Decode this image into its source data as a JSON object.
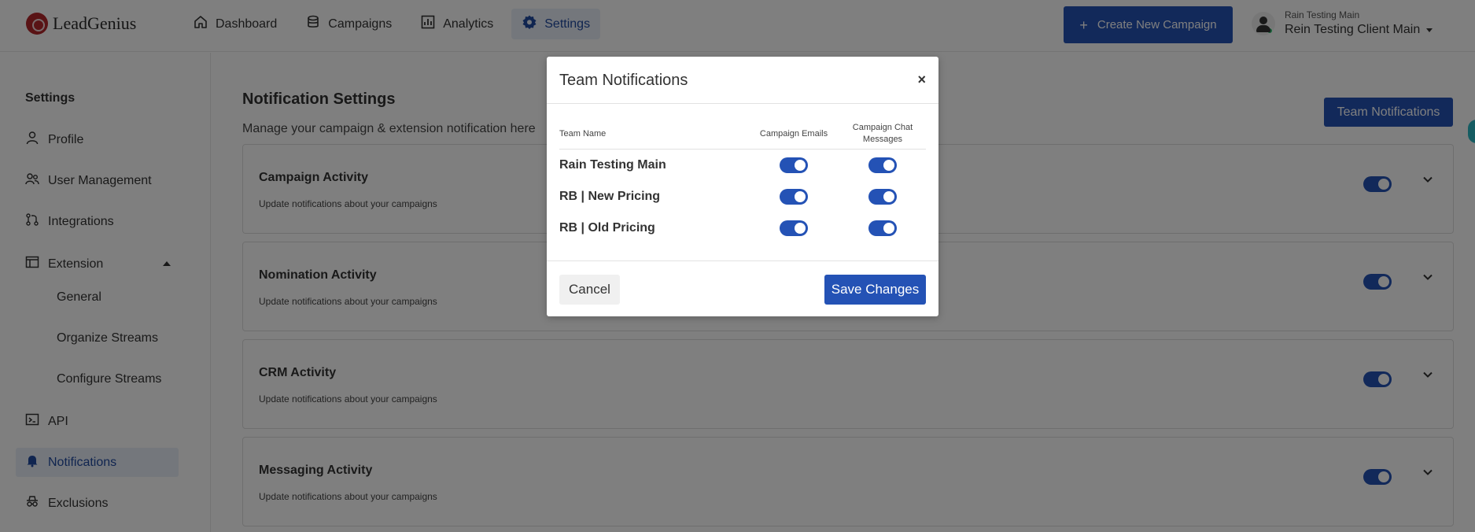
{
  "app": {
    "logo_text": "LeadGenius",
    "nav": [
      {
        "label": "Dashboard",
        "icon": "home-icon"
      },
      {
        "label": "Campaigns",
        "icon": "database-icon"
      },
      {
        "label": "Analytics",
        "icon": "chart-icon"
      },
      {
        "label": "Settings",
        "icon": "gear-icon"
      }
    ],
    "active_nav": "Settings",
    "create_button_label": "Create New Campaign",
    "account_small": "Rain Testing Main",
    "account_main": "Rein Testing Client Main"
  },
  "sidebar": {
    "title": "Settings",
    "items": [
      {
        "label": "Profile",
        "icon": "user-icon"
      },
      {
        "label": "User Management",
        "icon": "users-icon"
      },
      {
        "label": "Integrations",
        "icon": "integration-icon"
      },
      {
        "label": "Extension",
        "icon": "window-icon"
      },
      {
        "label": "API",
        "icon": "terminal-icon"
      },
      {
        "label": "Notifications",
        "icon": "bell-icon"
      },
      {
        "label": "Exclusions",
        "icon": "incognito-icon"
      }
    ],
    "extension_subitems": [
      "General",
      "Organize Streams",
      "Configure Streams"
    ],
    "active_item": "Notifications"
  },
  "main": {
    "title": "Notification Settings",
    "subtitle": "Manage your campaign & extension notification here",
    "team_notifications_button": "Team Notifications",
    "cards": [
      {
        "title": "Campaign Activity",
        "description": "Update notifications about your campaigns",
        "enabled": true
      },
      {
        "title": "Nomination Activity",
        "description": "Update notifications about your campaigns",
        "enabled": true
      },
      {
        "title": "CRM Activity",
        "description": "Update notifications about your campaigns",
        "enabled": true
      },
      {
        "title": "Messaging Activity",
        "description": "Update notifications about your campaigns",
        "enabled": true
      }
    ]
  },
  "modal": {
    "title": "Team Notifications",
    "close_glyph": "×",
    "columns": {
      "team_name": "Team Name",
      "campaign_emails": "Campaign Emails",
      "campaign_chat": "Campaign Chat Messages"
    },
    "rows": [
      {
        "team": "Rain Testing Main",
        "campaign_emails": true,
        "campaign_chat": true
      },
      {
        "team": "RB | New Pricing",
        "campaign_emails": true,
        "campaign_chat": true
      },
      {
        "team": "RB | Old Pricing",
        "campaign_emails": true,
        "campaign_chat": true
      }
    ],
    "cancel_label": "Cancel",
    "save_label": "Save Changes"
  },
  "colors": {
    "primary": "#2452b5",
    "active_bg": "#e8eef9",
    "overlay": "rgba(0,0,0,0.5)",
    "logo_red": "#b3262b"
  }
}
